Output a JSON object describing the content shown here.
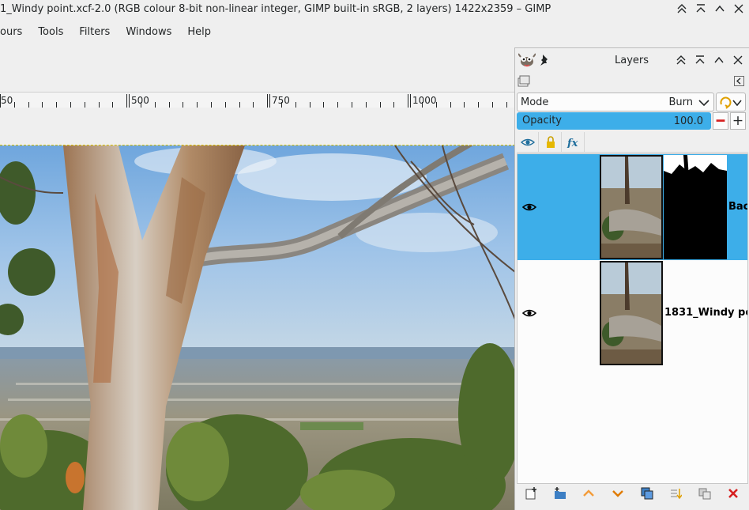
{
  "window": {
    "title": "1_Windy point.xcf-2.0 (RGB colour 8-bit non-linear integer, GIMP built-in sRGB, 2 layers) 1422x2359 – GIMP",
    "buttons": [
      "keep-above",
      "minimize",
      "maximize",
      "close"
    ]
  },
  "menubar": {
    "items": [
      "ours",
      "Tools",
      "Filters",
      "Windows",
      "Help"
    ]
  },
  "ruler": {
    "labels": [
      "50",
      "500",
      "750",
      "1000"
    ]
  },
  "layers_dock": {
    "title": "Layers",
    "mode_label": "Mode",
    "mode_value": "Burn",
    "opacity_label": "Opacity",
    "opacity_value": "100.0",
    "opacity_fraction": 1.0,
    "lock_icons": [
      "eye-icon",
      "lock-icon",
      "fx-icon"
    ],
    "layers": [
      {
        "name": "Bac",
        "selected": true,
        "visible": true,
        "has_mask": true
      },
      {
        "name": "1831_Windy poi",
        "selected": false,
        "visible": true,
        "has_mask": false
      }
    ],
    "bottom_buttons": [
      "new-layer-icon",
      "new-layer-group-icon",
      "raise-layer-icon",
      "lower-layer-icon",
      "duplicate-layer-icon",
      "anchor-layer-icon",
      "merge-layer-icon",
      "delete-layer-icon"
    ]
  },
  "colors": {
    "accent": "#3daee9",
    "delete_red": "#d62020",
    "arrow_orange": "#f39c3a"
  }
}
